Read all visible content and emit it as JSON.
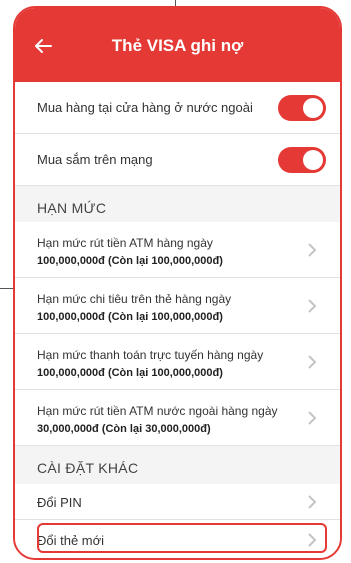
{
  "header": {
    "title": "Thẻ VISA ghi nợ"
  },
  "toggles": [
    {
      "label": "Mua hàng tại cửa hàng ở nước ngoài",
      "on": true
    },
    {
      "label": "Mua sắm trên mạng",
      "on": true
    }
  ],
  "limits": {
    "section_title": "HẠN MỨC",
    "items": [
      {
        "label": "Hạn mức rút tiền ATM hàng ngày",
        "value": "100,000,000đ (Còn lại 100,000,000đ)"
      },
      {
        "label": "Hạn mức chi tiêu trên thẻ hàng ngày",
        "value": "100,000,000đ (Còn lại 100,000,000đ)"
      },
      {
        "label": "Hạn mức thanh toán trực tuyến hàng ngày",
        "value": "100,000,000đ (Còn lại 100,000,000đ)"
      },
      {
        "label": "Hạn mức rút tiền ATM nước ngoài hàng ngày",
        "value": "30,000,000đ (Còn lại 30,000,000đ)"
      }
    ]
  },
  "other": {
    "section_title": "CÀI ĐẶT KHÁC",
    "items": [
      {
        "label": "Đổi PIN"
      },
      {
        "label": "Đổi thẻ mới"
      }
    ]
  },
  "colors": {
    "accent": "#e53935",
    "background": "#f4f4f4"
  },
  "icons": {
    "back": "arrow-left-icon",
    "chevron": "chevron-right-icon"
  }
}
